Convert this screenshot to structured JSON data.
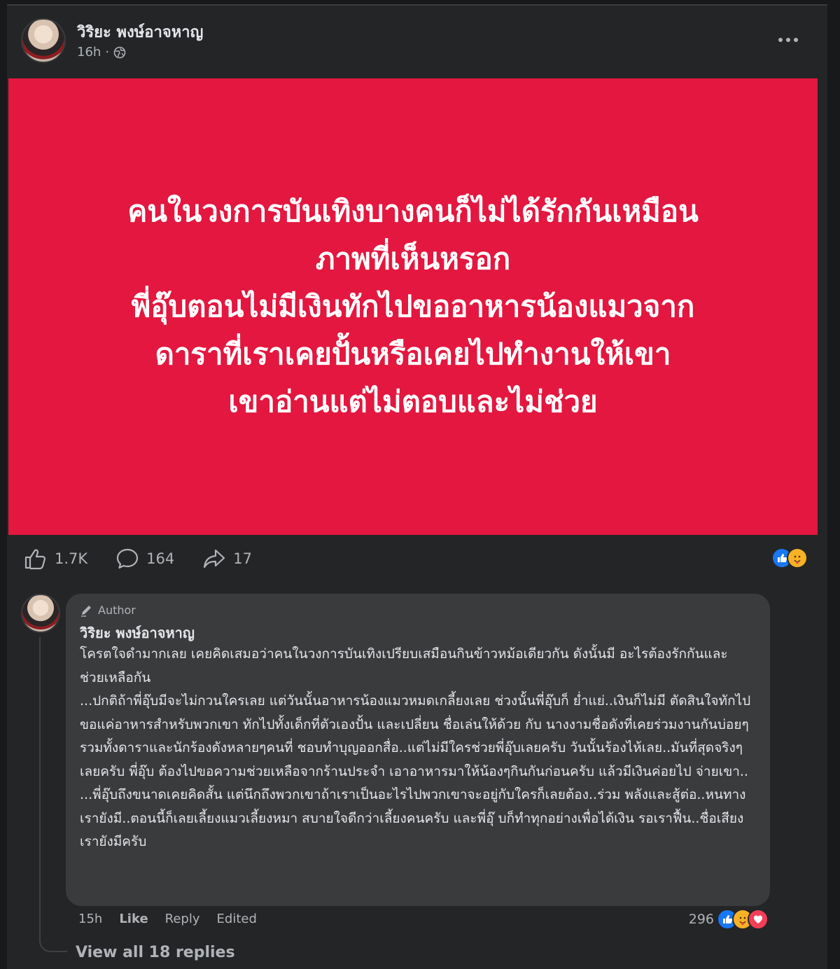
{
  "post": {
    "author": "วิริยะ พงษ์อาจหาญ",
    "time": "16h",
    "privacy_icon": "globe-icon",
    "more_icon": "more-options-icon",
    "banner": {
      "background": "#e3173f",
      "lines": [
        "คนในวงการบันเทิงบางคนก็ไม่ได้รักกันเหมือน",
        "ภาพที่เห็นหรอก",
        "พี่อุ๊บตอนไม่มีเงินทักไปขออาหารน้องแมวจาก",
        "ดาราที่เราเคยปั้นหรือเคยไปทำงานให้เขา",
        "เขาอ่านแต่ไม่ตอบและไม่ช่วย"
      ]
    },
    "stats": {
      "likes": "1.7K",
      "comments": "164",
      "shares": "17"
    }
  },
  "comment": {
    "badge": "Author",
    "author": "วิริยะ พงษ์อาจหาญ",
    "paragraphs": [
      "โครตใจดำมากเลย เคยคิดเสมอว่าคนในวงการบันเทิงเปรียบเสมือนกินข้าวหม้อเดียวกัน ดังนั้นมี อะไรต้องรักกันและช่วยเหลือกัน",
      "...ปกติถ้าพี่อุ๊บมีจะไม่กวนใครเลย แต่วันนั้นอาหารน้องแมวหมดเกลี้ยงเลย ช่วงนั้นพี่อุ๊บก็ ย่ำแย่..เงินก็ไม่มี ตัดสินใจทักไปขอแค่อาหารสำหรับพวกเขา ทักไปทั้งเด็กที่ตัวเองปั้น และเปลี่ยน ชื่อเล่นให้ด้วย กับ นางงามชื่อดังที่เคยร่วมงานกันบ่อยๆ รวมทั้งดาราและนักร้องดังหลายๆคนที่ ชอบทำบุญออกสื่อ..แต่ไม่มีใครช่วยพี่อุ๊บเลยครับ วันนั้นร้องไห้เลย..มันที่สุดจริงๆเลยครับ พี่อุ๊บ ต้องไปขอความช่วยเหลือจากร้านประจำ เอาอาหารมาให้น้องๆกินกันก่อนครับ แล้วมีเงินค่อยไป จ่ายเขา..",
      "...พี่อุ๊บถึงขนาดเคยคิดสั้น แต่นึกถึงพวกเขาถ้าเราเป็นอะไรไปพวกเขาจะอยู่กับใครก็เลยต้อง..ร่วม พลังและสู้ต่อ..หนทางเรายังมี..ตอนนี้ก็เลยเลี้ยงแมวเลี้ยงหมา สบายใจดีกว่าเลี้ยงคนครับ และพี่อุ๊ บก็ทำทุกอย่างเพื่อได้เงิน รอเราฟื้น..ชื่อเสียงเรายังมีครับ"
    ],
    "time": "15h",
    "like_label": "Like",
    "reply_label": "Reply",
    "edited_label": "Edited",
    "reaction_count": "296",
    "view_replies": "View all 18 replies"
  },
  "colors": {
    "page_bg": "#18191a",
    "card_bg": "#242526",
    "bubble_bg": "#3a3b3c",
    "banner_red": "#e3173f",
    "like_blue": "#1877f2",
    "love_red": "#f33e58",
    "care_yellow": "#f7b125"
  }
}
